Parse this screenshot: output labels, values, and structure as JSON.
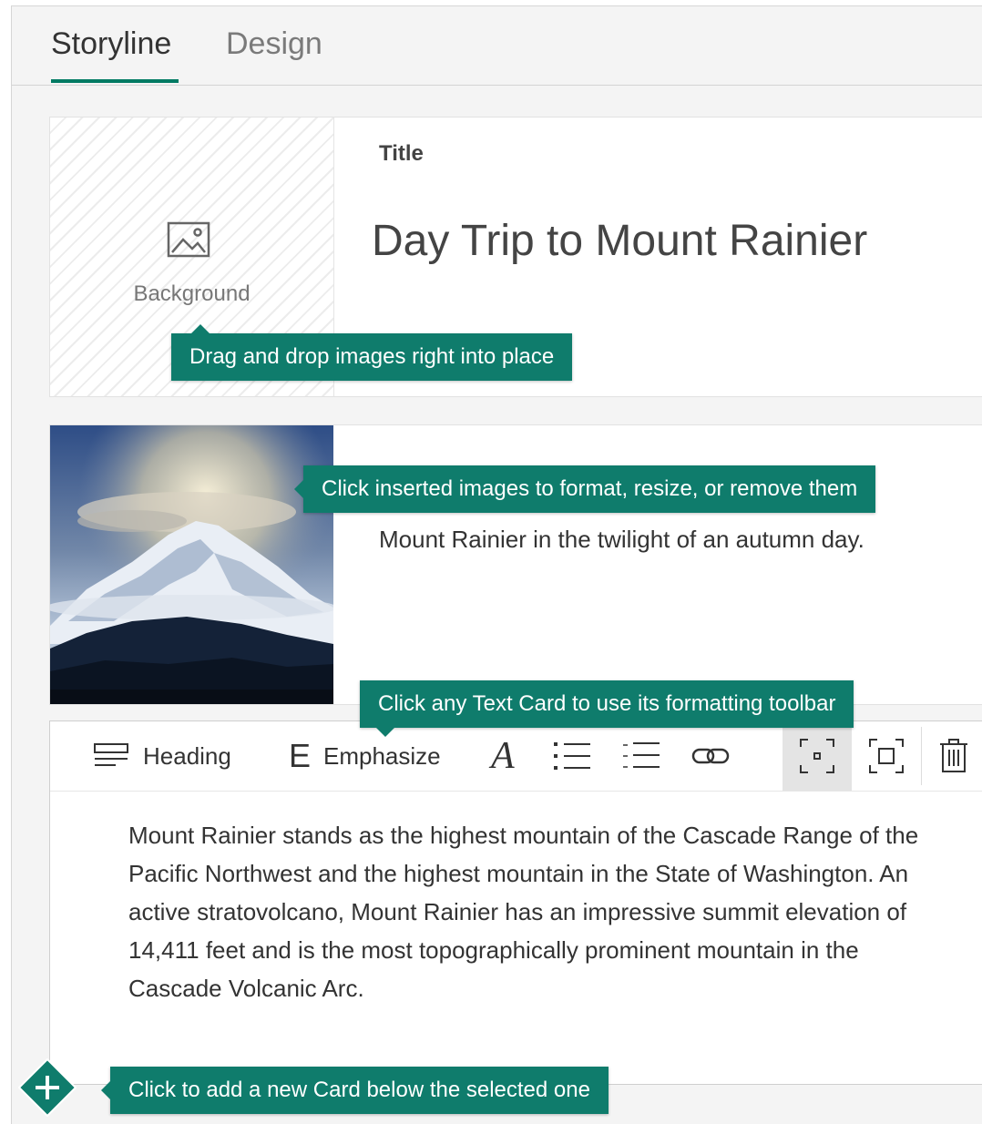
{
  "tabs": [
    {
      "label": "Storyline",
      "active": true
    },
    {
      "label": "Design",
      "active": false
    }
  ],
  "title_card": {
    "background_label": "Background",
    "background_icon": "image-icon",
    "field_label": "Title",
    "title": "Day Trip to Mount Rainier"
  },
  "image_card": {
    "caption": "Mount Rainier in the twilight of an autumn day."
  },
  "text_card": {
    "toolbar": {
      "heading_label": "Heading",
      "emphasize_label": "Emphasize",
      "emphasize_glyph": "E",
      "accent_glyph": "A",
      "icons": [
        "heading-icon",
        "emphasize-icon",
        "accent-icon",
        "bullet-list-icon",
        "numbered-list-icon",
        "link-icon",
        "focus-small-icon",
        "focus-large-icon",
        "delete-icon"
      ]
    },
    "body": "Mount Rainier stands as the highest mountain of the Cascade Range of the Pacific Northwest and the highest mountain in the State of Washington. An active stratovolcano, Mount Rainier has an impressive summit elevation of 14,411 feet and is the most topographically prominent mountain in the Cascade Volcanic Arc."
  },
  "callouts": {
    "drag_drop": "Drag and drop images right into place",
    "inserted_images": "Click inserted images to format, resize, or remove them",
    "text_card": "Click any Text Card to use its formatting toolbar",
    "add_card": "Click to add a new Card below the selected one"
  },
  "add_button": {
    "glyph": "+",
    "icon": "plus-icon"
  },
  "colors": {
    "accent": "#007a63",
    "callout": "#0f7c6c",
    "panel": "#f4f4f4",
    "card": "#ffffff"
  }
}
